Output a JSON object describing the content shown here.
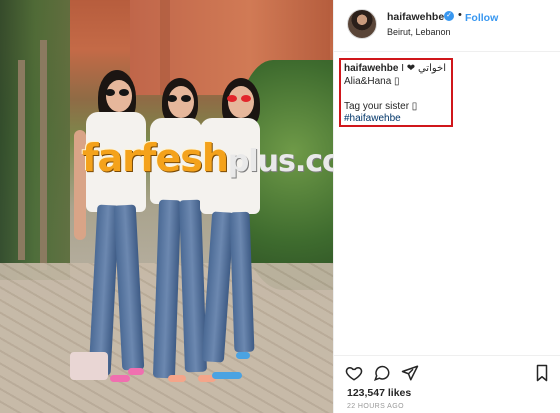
{
  "post": {
    "image_alt": "Three women posing on a brick path",
    "watermark": {
      "brand_main": "farfesh",
      "brand_suffix": "plus.com"
    }
  },
  "header": {
    "username": "haifawehbe",
    "verified": true,
    "separator": "•",
    "follow_label": "Follow",
    "location": "Beirut, Lebanon"
  },
  "caption": {
    "username": "haifawehbe",
    "line1_text": "I ❤ اخواتي",
    "line2_text": "Alia&Hana ▯",
    "line3_text": "Tag your sister ▯",
    "hashtag": "#haifawehbe",
    "highlight_color": "#d0161b"
  },
  "actions": {
    "icons": [
      "heart-icon",
      "comment-icon",
      "share-icon",
      "bookmark-icon"
    ]
  },
  "stats": {
    "likes": "123,547 likes",
    "timestamp": "22 HOURS AGO"
  },
  "colors": {
    "accent": "#3897f0",
    "text": "#262626",
    "muted": "#999999"
  }
}
